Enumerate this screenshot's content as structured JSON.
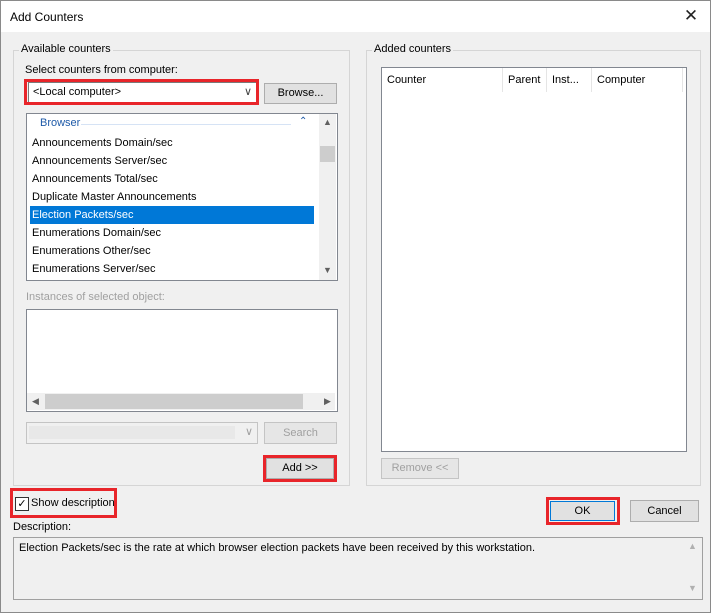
{
  "window": {
    "title": "Add Counters",
    "close_label": "✕"
  },
  "available": {
    "group_label": "Available counters",
    "select_label": "Select counters from computer:",
    "computer_value": "<Local computer>",
    "browse_label": "Browse...",
    "category": "Browser",
    "counters": [
      "Announcements Domain/sec",
      "Announcements Server/sec",
      "Announcements Total/sec",
      "Duplicate Master Announcements",
      "Election Packets/sec",
      "Enumerations Domain/sec",
      "Enumerations Other/sec",
      "Enumerations Server/sec"
    ],
    "selected_counter": "Election Packets/sec",
    "instances_label": "Instances of selected object:",
    "search_label": "Search",
    "add_label": "Add >>"
  },
  "added": {
    "group_label": "Added counters",
    "columns": [
      "Counter",
      "Parent",
      "Inst...",
      "Computer"
    ],
    "remove_label": "Remove <<"
  },
  "show_description": {
    "label": "Show description",
    "checked": true,
    "check_glyph": "✓"
  },
  "buttons": {
    "ok": "OK",
    "cancel": "Cancel"
  },
  "description": {
    "label": "Description:",
    "text": "Election Packets/sec is the rate at which browser election packets have been received by this workstation."
  },
  "colors": {
    "highlight": "#e8252a",
    "selection": "#0078d7"
  }
}
